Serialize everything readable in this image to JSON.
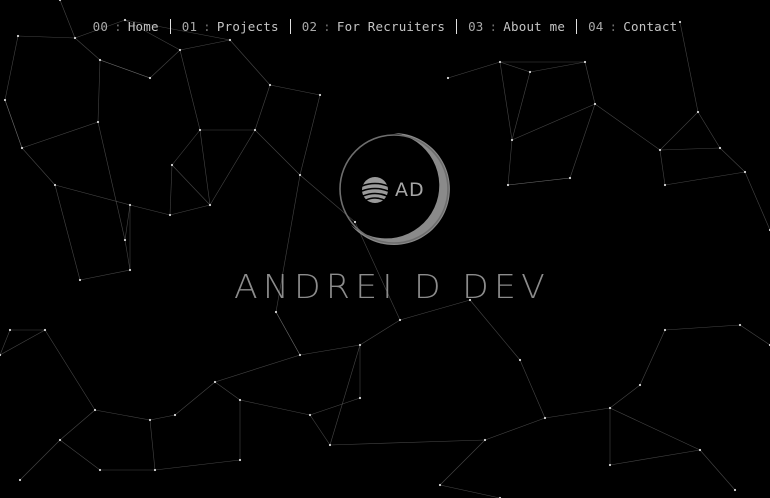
{
  "nav": {
    "items": [
      {
        "num": "00",
        "label": "Home"
      },
      {
        "num": "01",
        "label": "Projects"
      },
      {
        "num": "02",
        "label": "For Recruiters"
      },
      {
        "num": "03",
        "label": "About me"
      },
      {
        "num": "04",
        "label": "Contact"
      }
    ],
    "separator": ":"
  },
  "logo": {
    "monogram": "AD",
    "icon": "globe-icon"
  },
  "hero": {
    "title": "ANDREI D DEV"
  },
  "colors": {
    "background": "#000000",
    "nav_text": "#c4c4c4",
    "logo_ring": "#8a8a8a",
    "wordmark": "#8c8c8c",
    "network_line": "#9a9a9a"
  },
  "background_icon": "particle-network"
}
